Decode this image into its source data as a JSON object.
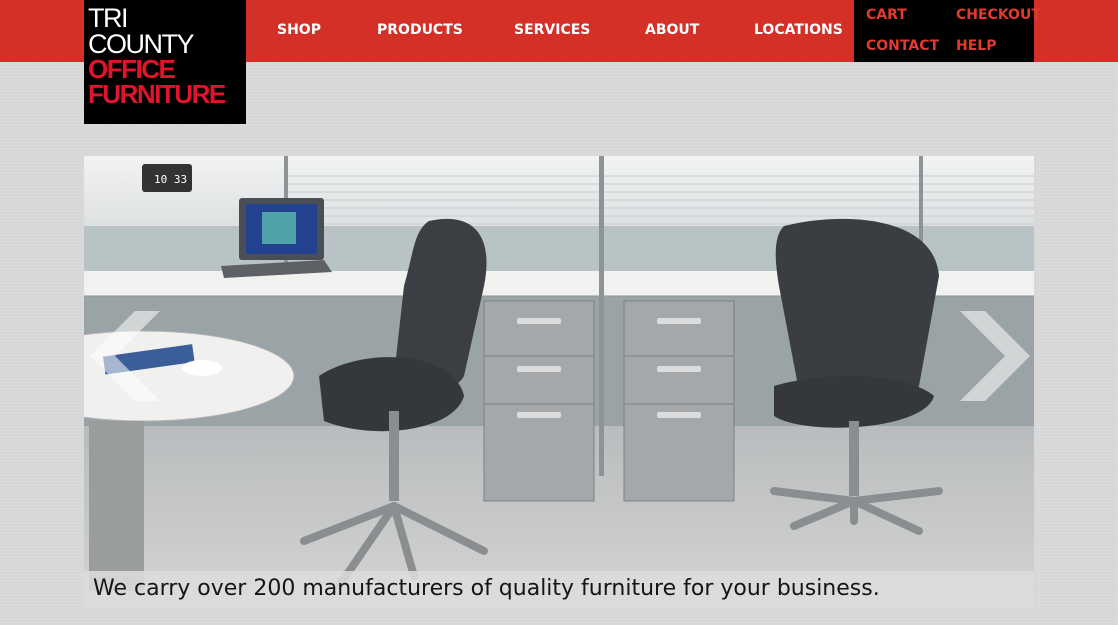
{
  "logo": {
    "line1": "TRI",
    "line2": "COUNTY",
    "line3": "OFFICE",
    "line4": "FURNITURE"
  },
  "nav": {
    "shop": "SHOP",
    "products": "PRODUCTS",
    "services": "SERVICES",
    "about": "ABOUT",
    "locations": "LOCATIONS"
  },
  "utility": {
    "cart": "CART",
    "checkout": "CHECKOUT",
    "contact": "CONTACT",
    "help": "HELP"
  },
  "hero": {
    "caption": "We carry over 200 manufacturers of quality furniture for your business.",
    "clock": "10 33",
    "prev_icon": "chevron-left-icon",
    "next_icon": "chevron-right-icon"
  },
  "colors": {
    "brand_red": "#d43027",
    "logo_red": "#e0142b",
    "black": "#000000"
  }
}
